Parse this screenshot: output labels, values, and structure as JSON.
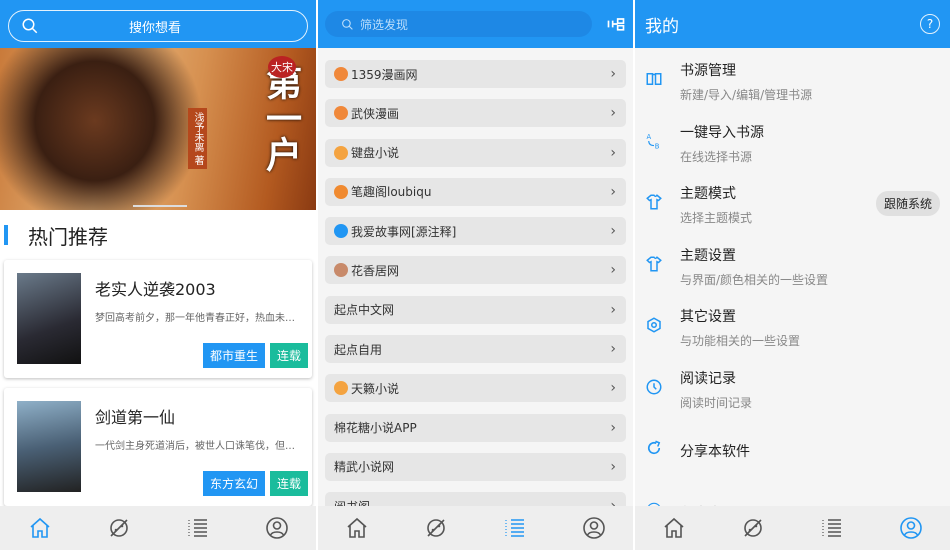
{
  "colors": {
    "accent": "#2196f3",
    "tag_genre": "#2196f3",
    "tag_status": "#1abc9c"
  },
  "home": {
    "search_placeholder": "搜你想看",
    "banner": {
      "title": "第一户",
      "badge": "大宋",
      "author": "浅予未离 著"
    },
    "section_title": "热门推荐",
    "books": [
      {
        "title": "老实人逆袭2003",
        "desc": "梦回高考前夕，那一年他青春正好，热血未…",
        "genre": "都市重生",
        "status": "连载"
      },
      {
        "title": "剑道第一仙",
        "desc": "一代剑主身死道消后，被世人口诛笔伐，但…",
        "genre": "东方玄幻",
        "status": "连载"
      }
    ]
  },
  "discover": {
    "search_placeholder": "筛选发现",
    "sources": [
      {
        "label": "1359漫画网",
        "icon": "orange-fan-icon"
      },
      {
        "label": "武侠漫画",
        "icon": "orange-fan-icon"
      },
      {
        "label": "键盘小说",
        "icon": "party-popper-icon"
      },
      {
        "label": "笔趣阁loubiqu",
        "icon": "flame-icon"
      },
      {
        "label": "我爱故事网[源注释]",
        "icon": "target-icon"
      },
      {
        "label": "花香居网",
        "icon": "flower-icon"
      },
      {
        "label": "起点中文网",
        "icon": ""
      },
      {
        "label": "起点自用",
        "icon": ""
      },
      {
        "label": "天籁小说",
        "icon": "party-popper-icon"
      },
      {
        "label": "棉花糖小说APP",
        "icon": ""
      },
      {
        "label": "精武小说网",
        "icon": ""
      },
      {
        "label": "阅书阁",
        "icon": ""
      }
    ]
  },
  "mine": {
    "title": "我的",
    "help": "?",
    "items": [
      {
        "title": "书源管理",
        "sub": "新建/导入/编辑/管理书源",
        "icon": "book-icon"
      },
      {
        "title": "一键导入书源",
        "sub": "在线选择书源",
        "icon": "a-to-b-icon"
      },
      {
        "title": "主题模式",
        "sub": "选择主题模式",
        "icon": "shirt-icon",
        "value": "跟随系统"
      },
      {
        "title": "主题设置",
        "sub": "与界面/颜色相关的一些设置",
        "icon": "shirt-icon"
      },
      {
        "title": "其它设置",
        "sub": "与功能相关的一些设置",
        "icon": "settings-icon"
      },
      {
        "title": "阅读记录",
        "sub": "阅读时间记录",
        "icon": "clock-icon"
      },
      {
        "title": "分享本软件",
        "icon": "share-icon"
      },
      {
        "title": "免责声明",
        "icon": "info-icon"
      }
    ]
  }
}
